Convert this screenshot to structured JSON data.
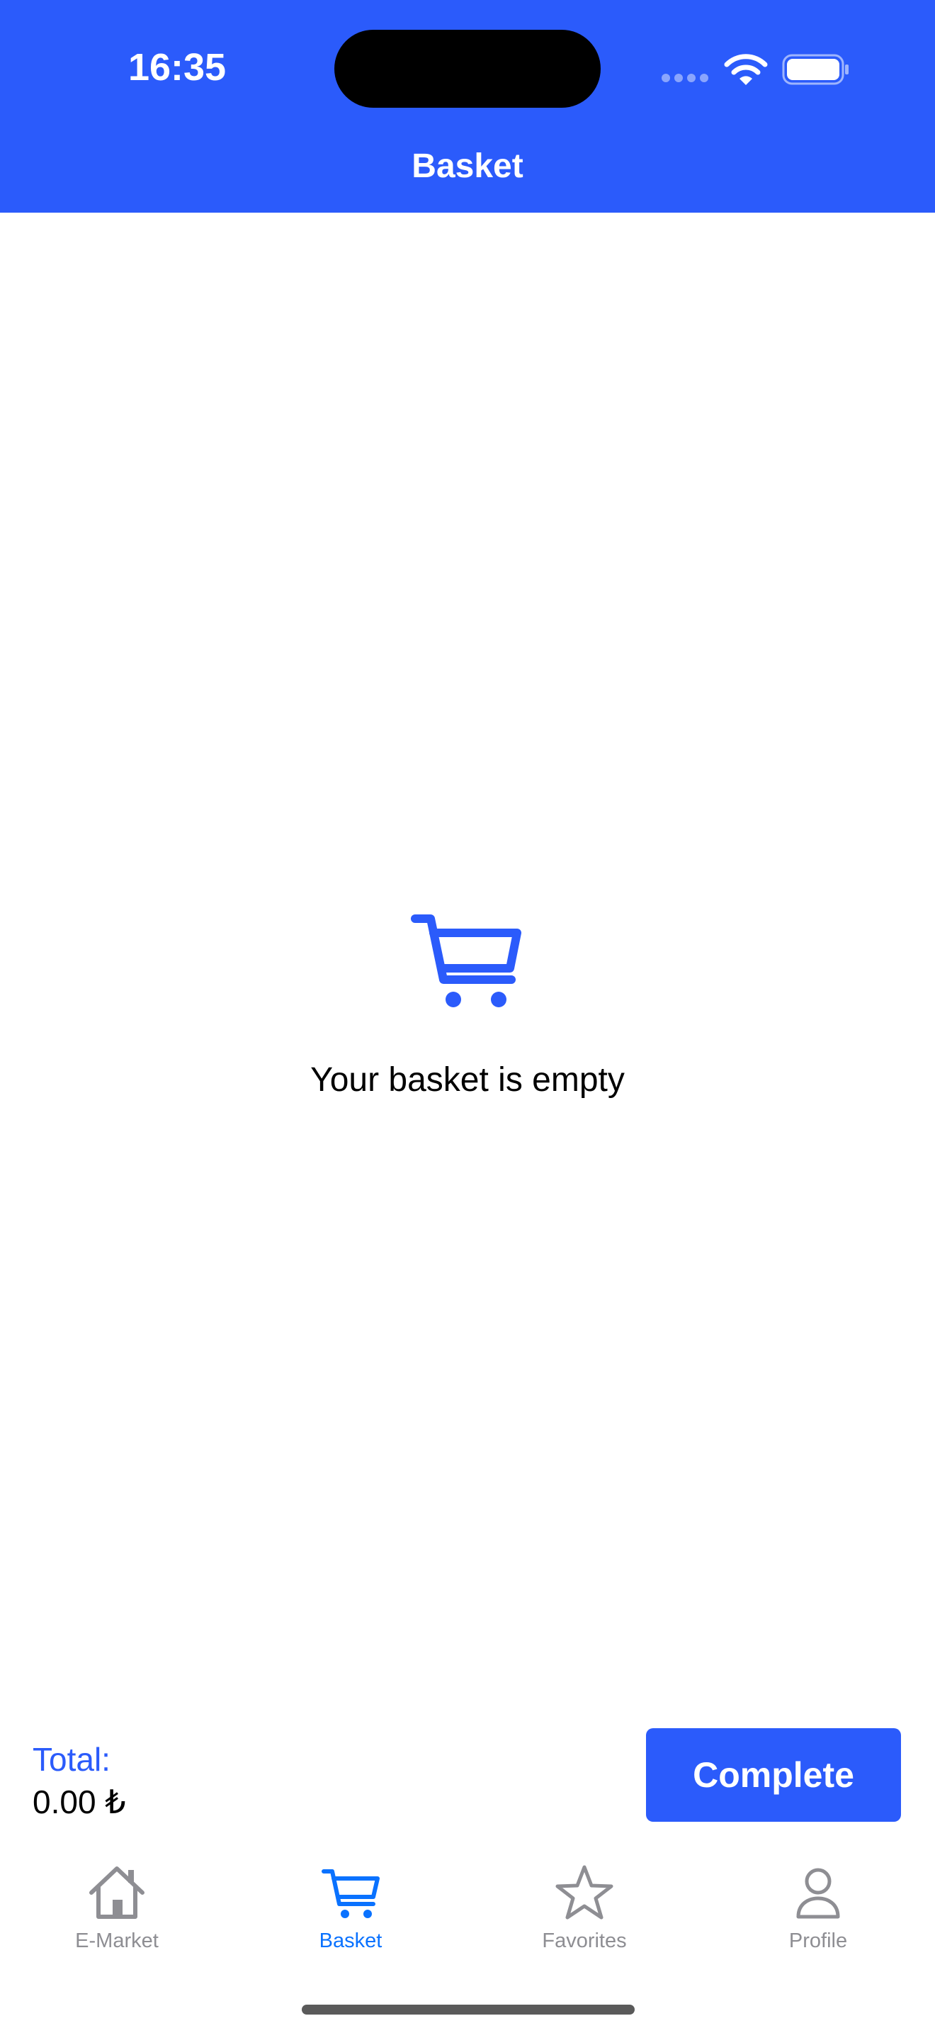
{
  "status_bar": {
    "time": "16:35"
  },
  "header": {
    "title": "Basket"
  },
  "empty_state": {
    "icon": "cart-icon",
    "message": "Your basket is empty"
  },
  "footer": {
    "total_label": "Total:",
    "total_value": "0.00 ₺",
    "complete_label": "Complete"
  },
  "tabs": [
    {
      "label": "E-Market",
      "icon": "home-icon",
      "active": false
    },
    {
      "label": "Basket",
      "icon": "cart-icon",
      "active": true
    },
    {
      "label": "Favorites",
      "icon": "star-icon",
      "active": false
    },
    {
      "label": "Profile",
      "icon": "person-icon",
      "active": false
    }
  ],
  "colors": {
    "accent": "#2b5bfb",
    "tab_active": "#0a72ff",
    "tab_inactive": "#8e8e93"
  }
}
